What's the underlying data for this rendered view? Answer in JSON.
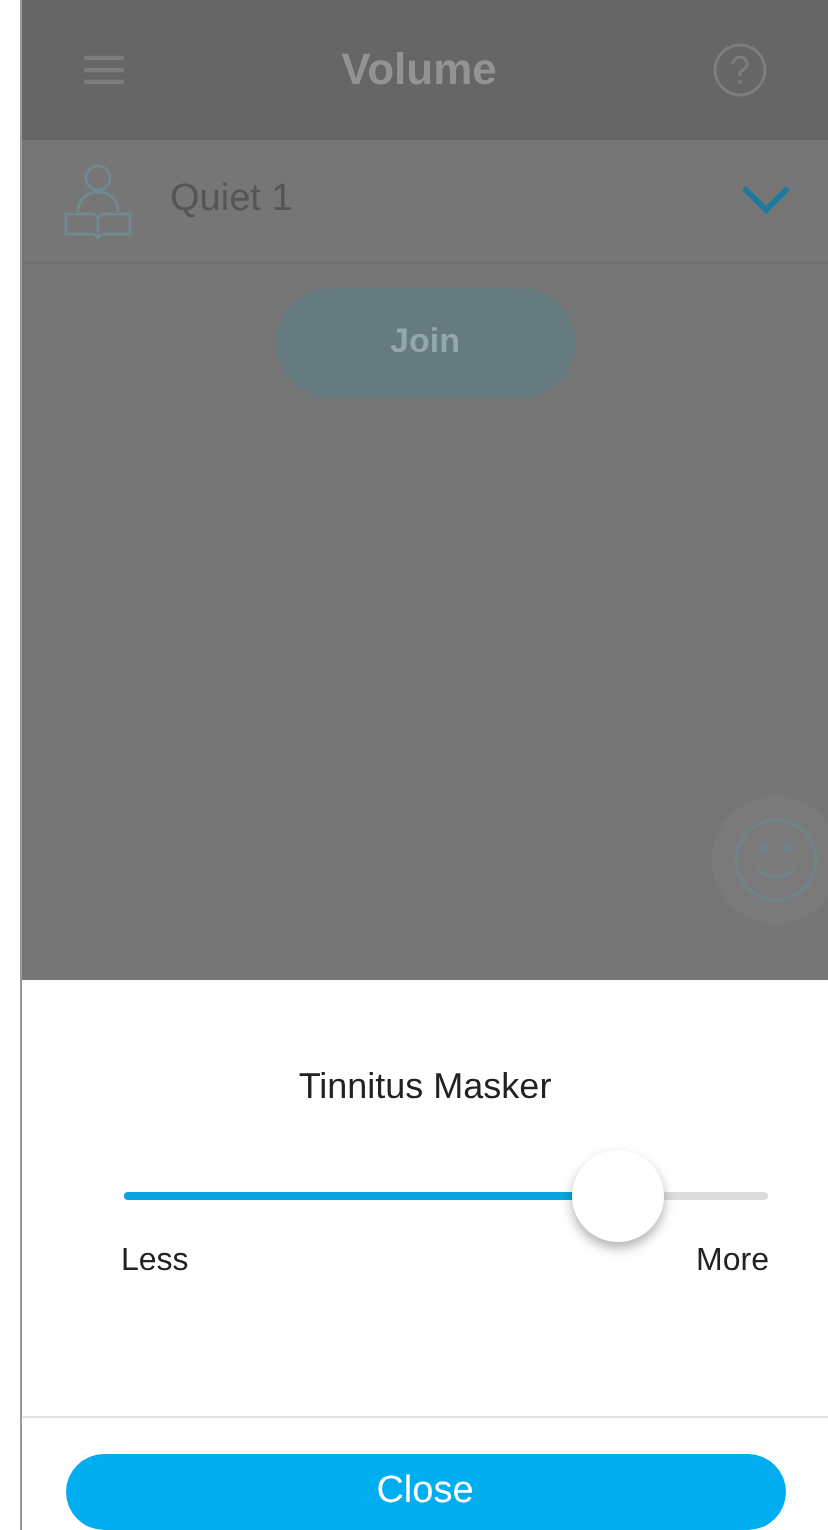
{
  "app_bar": {
    "title": "Volume"
  },
  "program": {
    "name": "Quiet 1",
    "expanded": false
  },
  "join_button": {
    "label": "Join"
  },
  "sheet": {
    "title": "Tinnitus Masker",
    "slider": {
      "level": 0.77,
      "min_label": "Less",
      "max_label": "More"
    }
  },
  "close_button": {
    "label": "Close"
  }
}
